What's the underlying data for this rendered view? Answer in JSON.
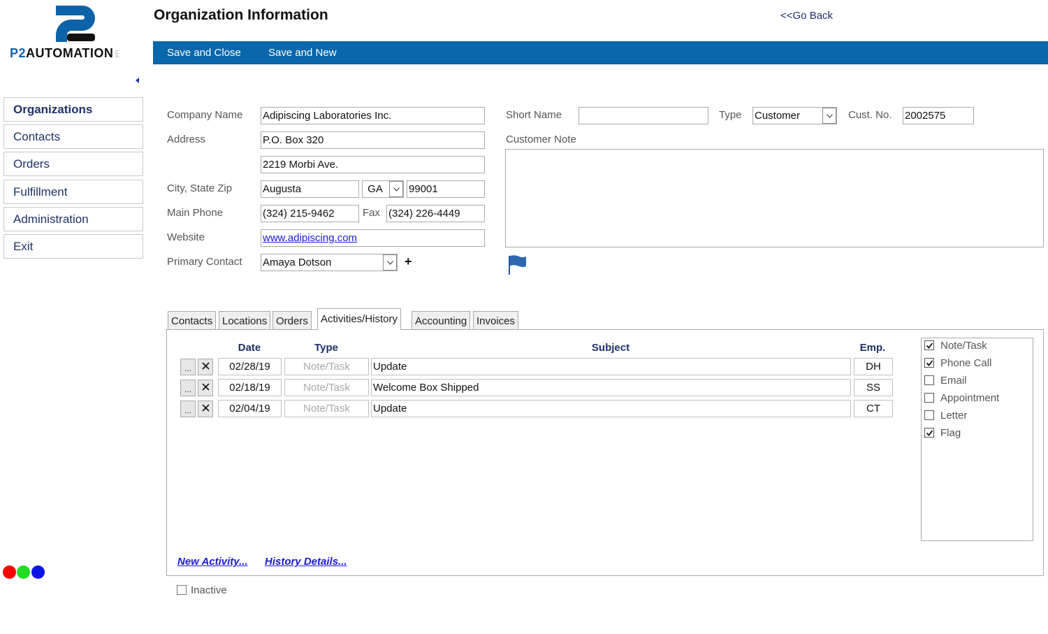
{
  "brand": {
    "logo_prefix": "P2",
    "logo_word": "AUTOMATION",
    "logo_suffix": "LLC",
    "accent_color": "#0967ab"
  },
  "header": {
    "title": "Organization Information",
    "go_back": "<<Go Back"
  },
  "toolbar": {
    "save_close": "Save and Close",
    "save_new": "Save and New"
  },
  "sidebar": {
    "items": [
      {
        "label": "Organizations",
        "active": true
      },
      {
        "label": "Contacts",
        "active": false
      },
      {
        "label": "Orders",
        "active": false
      },
      {
        "label": "Fulfillment",
        "active": false
      },
      {
        "label": "Administration",
        "active": false
      },
      {
        "label": "Exit",
        "active": false
      }
    ]
  },
  "form": {
    "company_name_label": "Company Name",
    "company_name": "Adipiscing Laboratories Inc.",
    "address_label": "Address",
    "address1": "P.O. Box 320",
    "address2": "2219 Morbi Ave.",
    "city_label": "City, State Zip",
    "city": "Augusta",
    "state": "GA",
    "zip": "99001",
    "phone_label": "Main Phone",
    "phone": "(324) 215-9462",
    "fax_label": "Fax",
    "fax": "(324) 226-4449",
    "website_label": "Website",
    "website": "www.adipiscing.com",
    "primary_contact_label": "Primary Contact",
    "primary_contact": "Amaya Dotson",
    "add_contact": "+",
    "short_name_label": "Short Name",
    "short_name": "",
    "type_label": "Type",
    "type": "Customer",
    "cust_no_label": "Cust. No.",
    "cust_no": "2002575",
    "customer_note_label": "Customer Note",
    "customer_note": ""
  },
  "tabs": [
    {
      "label": "Contacts",
      "active": false
    },
    {
      "label": "Locations",
      "active": false
    },
    {
      "label": "Orders",
      "active": false
    },
    {
      "label": "Activities/History",
      "active": true
    },
    {
      "label": "Accounting",
      "active": false
    },
    {
      "label": "Invoices",
      "active": false
    }
  ],
  "activities": {
    "columns": {
      "date": "Date",
      "type": "Type",
      "subject": "Subject",
      "emp": "Emp."
    },
    "more_label": "...",
    "rows": [
      {
        "date": "02/28/19",
        "type": "Note/Task",
        "subject": "Update",
        "emp": "DH"
      },
      {
        "date": "02/18/19",
        "type": "Note/Task",
        "subject": "Welcome Box Shipped",
        "emp": "SS"
      },
      {
        "date": "02/04/19",
        "type": "Note/Task",
        "subject": "Update",
        "emp": "CT"
      }
    ],
    "filters": [
      {
        "label": "Note/Task",
        "checked": true
      },
      {
        "label": "Phone Call",
        "checked": true
      },
      {
        "label": "Email",
        "checked": false
      },
      {
        "label": "Appointment",
        "checked": false
      },
      {
        "label": "Letter",
        "checked": false
      },
      {
        "label": "Flag",
        "checked": true
      }
    ],
    "new_activity": "New Activity...",
    "history_details": "History Details..."
  },
  "inactive": {
    "label": "Inactive",
    "checked": false
  },
  "color_dots": [
    "#ff0000",
    "#22dd22",
    "#0a14e6"
  ]
}
